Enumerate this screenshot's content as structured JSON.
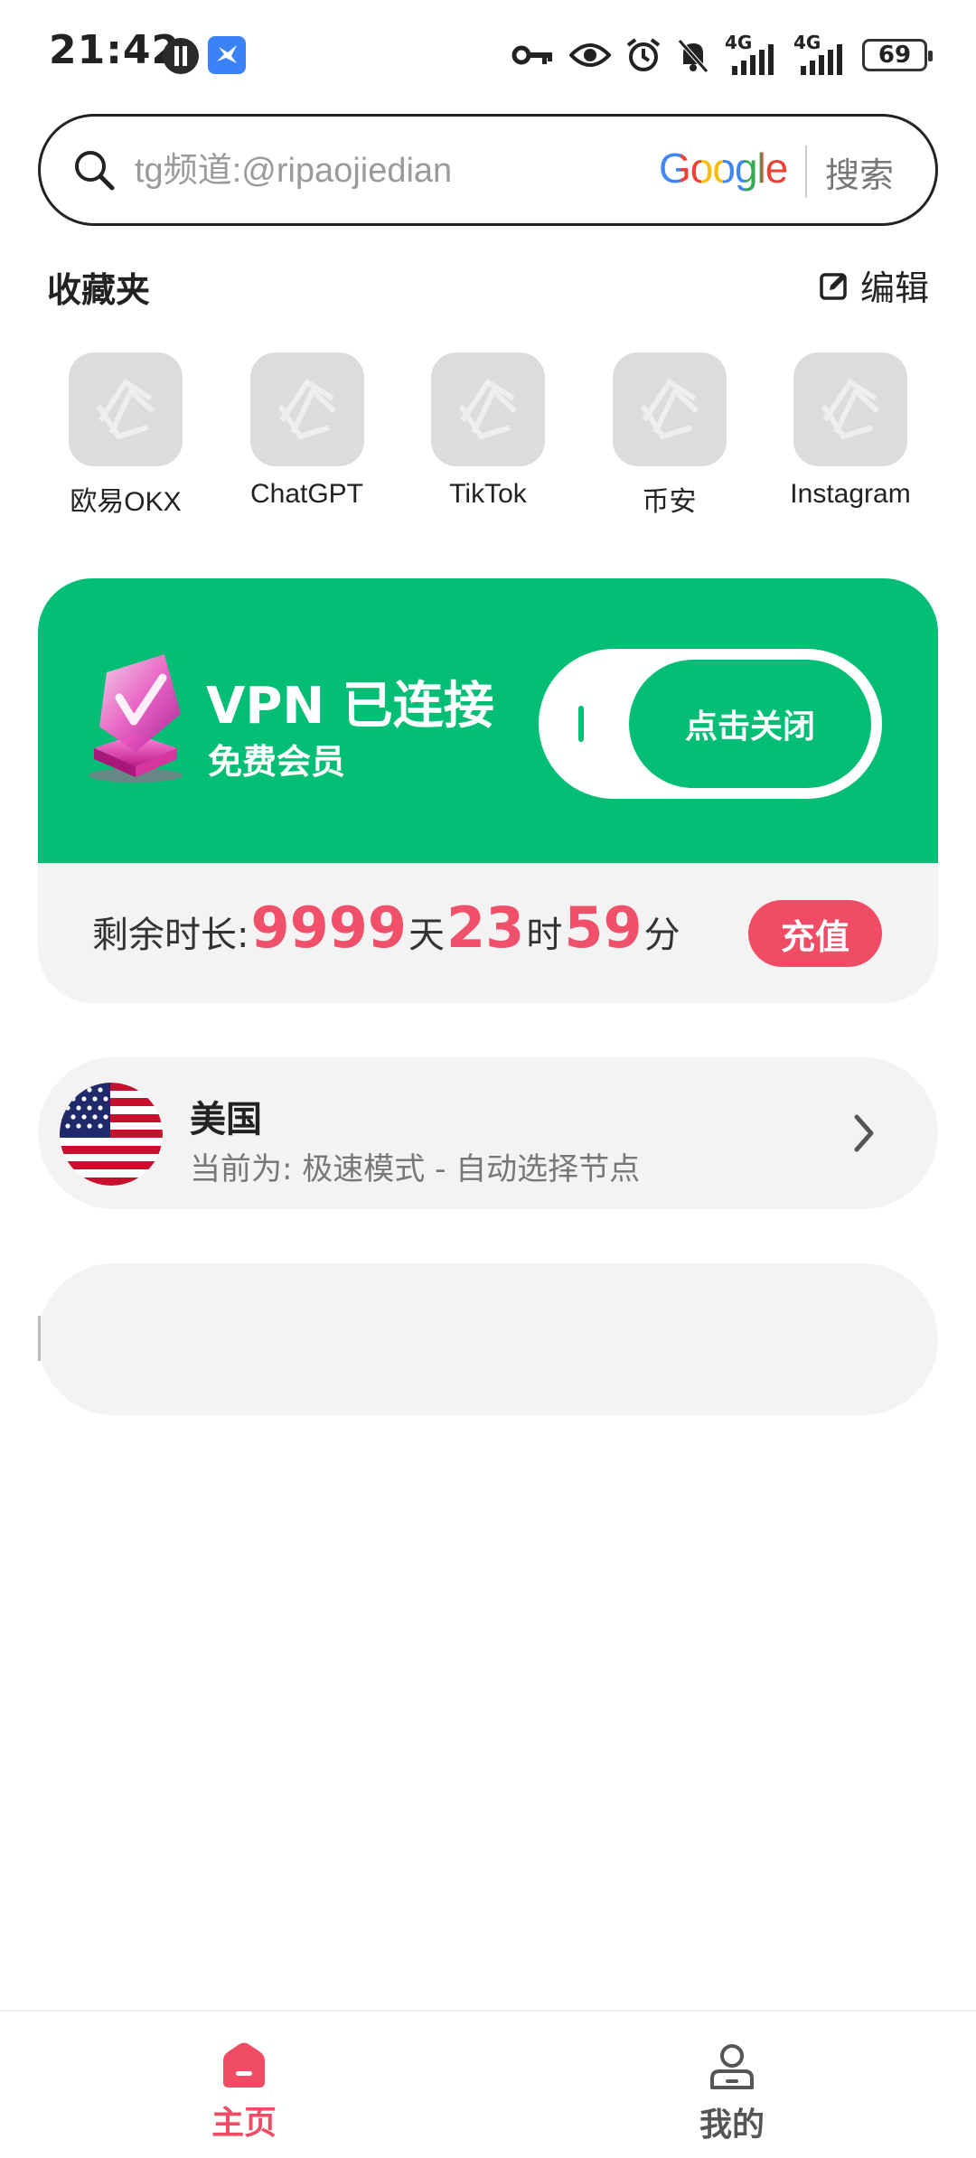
{
  "status_bar": {
    "time": "21:42",
    "network_1": "4G",
    "network_2": "4G",
    "battery": "69",
    "icons": [
      "app-notification-icon",
      "bird-app-icon",
      "key-icon",
      "eye-icon",
      "alarm-icon",
      "bell-muted-icon",
      "signal-icon",
      "signal-icon",
      "battery-icon"
    ]
  },
  "search": {
    "placeholder": "tg频道:@ripaojiedian",
    "engine_logo": "Google",
    "button_label": "搜索"
  },
  "favorites": {
    "title": "收藏夹",
    "edit_label": "编辑",
    "items": [
      {
        "label": "欧易OKX"
      },
      {
        "label": "ChatGPT"
      },
      {
        "label": "TikTok"
      },
      {
        "label": "币安"
      },
      {
        "label": "Instagram"
      }
    ]
  },
  "vpn": {
    "status": "VPN 已连接",
    "membership": "免费会员",
    "toggle_label": "点击关闭",
    "remaining_label": "剩余时长:",
    "days": "9999",
    "days_unit": "天",
    "hours": "23",
    "hours_unit": "时",
    "minutes": "59",
    "minutes_unit": "分",
    "recharge_label": "充值",
    "accent_color": "#03be74",
    "highlight_color": "#f1506a"
  },
  "server": {
    "country": "美国",
    "mode": "当前为: 极速模式 - 自动选择节点"
  },
  "bottom_nav": {
    "home_label": "主页",
    "mine_label": "我的"
  }
}
